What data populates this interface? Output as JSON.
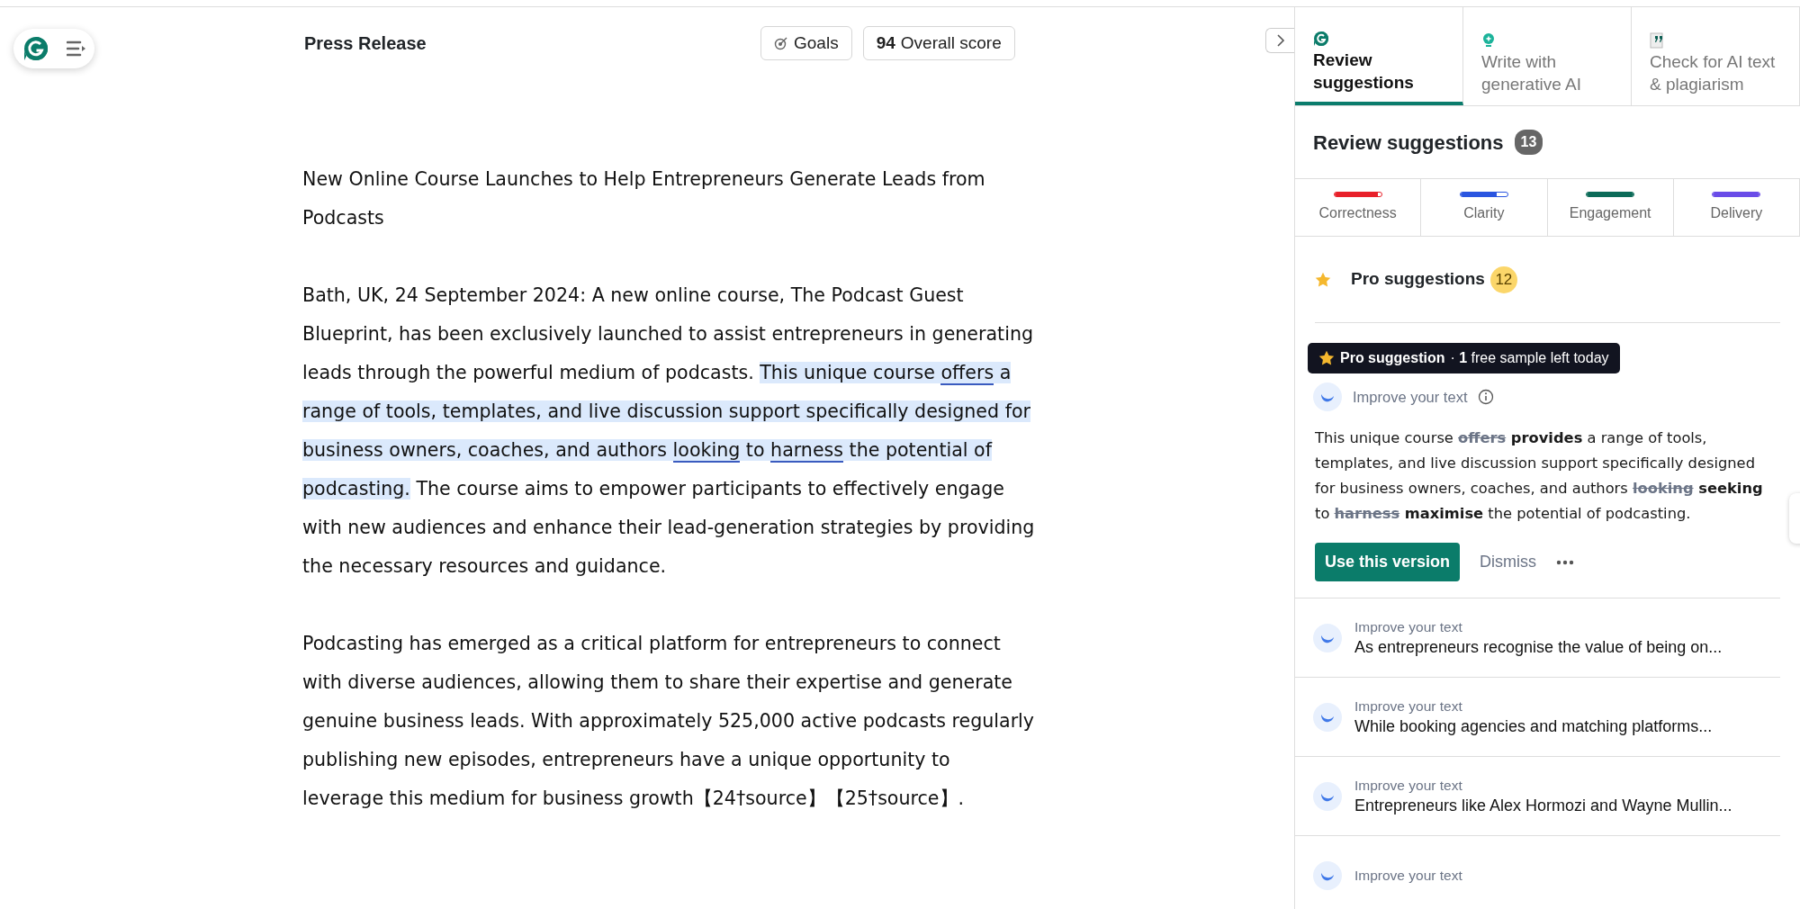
{
  "editor": {
    "title": "Press Release",
    "goals_button": "Goals",
    "score": {
      "value": "94",
      "label": "Overall score"
    },
    "paragraphs": [
      [
        {
          "text": "New Online Course Launches to Help Entrepreneurs Generate Leads from Podcasts",
          "kind": "plain"
        }
      ],
      [
        {
          "text": "Bath, UK, 24 September 2024: A new online course, The Podcast Guest Blueprint, has been exclusively launched to assist entrepreneurs in generating leads through the powerful medium of podcasts. ",
          "kind": "plain"
        },
        {
          "text": "This unique course ",
          "kind": "highlighted"
        },
        {
          "text": "offers",
          "kind": "flagged"
        },
        {
          "text": " a range of tools, templates, and live discussion support specifically designed for business owners, coaches, and authors ",
          "kind": "highlighted"
        },
        {
          "text": "looking",
          "kind": "flagged"
        },
        {
          "text": " to ",
          "kind": "highlighted"
        },
        {
          "text": "harness",
          "kind": "flagged"
        },
        {
          "text": " the potential of podcasting.",
          "kind": "highlighted"
        },
        {
          "text": " The course aims to empower participants to effectively engage with new audiences and enhance their lead-generation strategies by providing the necessary resources and guidance.",
          "kind": "plain"
        }
      ],
      [
        {
          "text": "Podcasting has emerged as a critical platform for entrepreneurs to connect with diverse audiences, allowing them to share their expertise and generate genuine business leads. With approximately 525,000 active podcasts regularly publishing new episodes, entrepreneurs have a unique opportunity to leverage this medium for business growth【24†source】【25†source】.",
          "kind": "plain"
        }
      ]
    ]
  },
  "panel": {
    "tabs": [
      {
        "label": "Review suggestions",
        "selected": true
      },
      {
        "label": "Write with generative AI",
        "selected": false
      },
      {
        "label": "Check for AI text & plagiarism",
        "selected": false
      }
    ],
    "heading": "Review suggestions",
    "count": "13",
    "categories": [
      {
        "label": "Correctness",
        "color": "#e8202a",
        "level": 0.93
      },
      {
        "label": "Clarity",
        "color": "#2a55e0",
        "level": 0.78
      },
      {
        "label": "Engagement",
        "color": "#0c6b58",
        "level": 1
      },
      {
        "label": "Delivery",
        "color": "#6a4ce8",
        "level": 1
      }
    ],
    "pro": {
      "label": "Pro suggestions",
      "count": "12"
    },
    "banner": {
      "title": "Pro suggestion",
      "note": "· **1** free sample left today"
    },
    "card": {
      "type": "Improve your text",
      "segments": [
        {
          "text": "This unique course ",
          "kind": "plain"
        },
        {
          "text": "offers",
          "kind": "deleted"
        },
        {
          "text": " provides",
          "kind": "inserted"
        },
        {
          "text": " a range of tools, templates, and live discussion support specifically designed for business owners, coaches, and authors ",
          "kind": "plain"
        },
        {
          "text": "looking",
          "kind": "deleted"
        },
        {
          "text": " seeking",
          "kind": "inserted"
        },
        {
          "text": " to ",
          "kind": "plain"
        },
        {
          "text": "harness",
          "kind": "deleted"
        },
        {
          "text": " maximise",
          "kind": "inserted"
        },
        {
          "text": " the potential of podcasting.",
          "kind": "plain"
        }
      ],
      "accept": "Use this version",
      "dismiss": "Dismiss"
    },
    "items": [
      {
        "type": "Improve your text",
        "text": "As entrepreneurs recognise the value of being on..."
      },
      {
        "type": "Improve your text",
        "text": "While booking agencies and matching platforms..."
      },
      {
        "type": "Improve your text",
        "text": "Entrepreneurs like Alex Hormozi and Wayne Mullin..."
      },
      {
        "type": "Improve your text"
      }
    ]
  }
}
